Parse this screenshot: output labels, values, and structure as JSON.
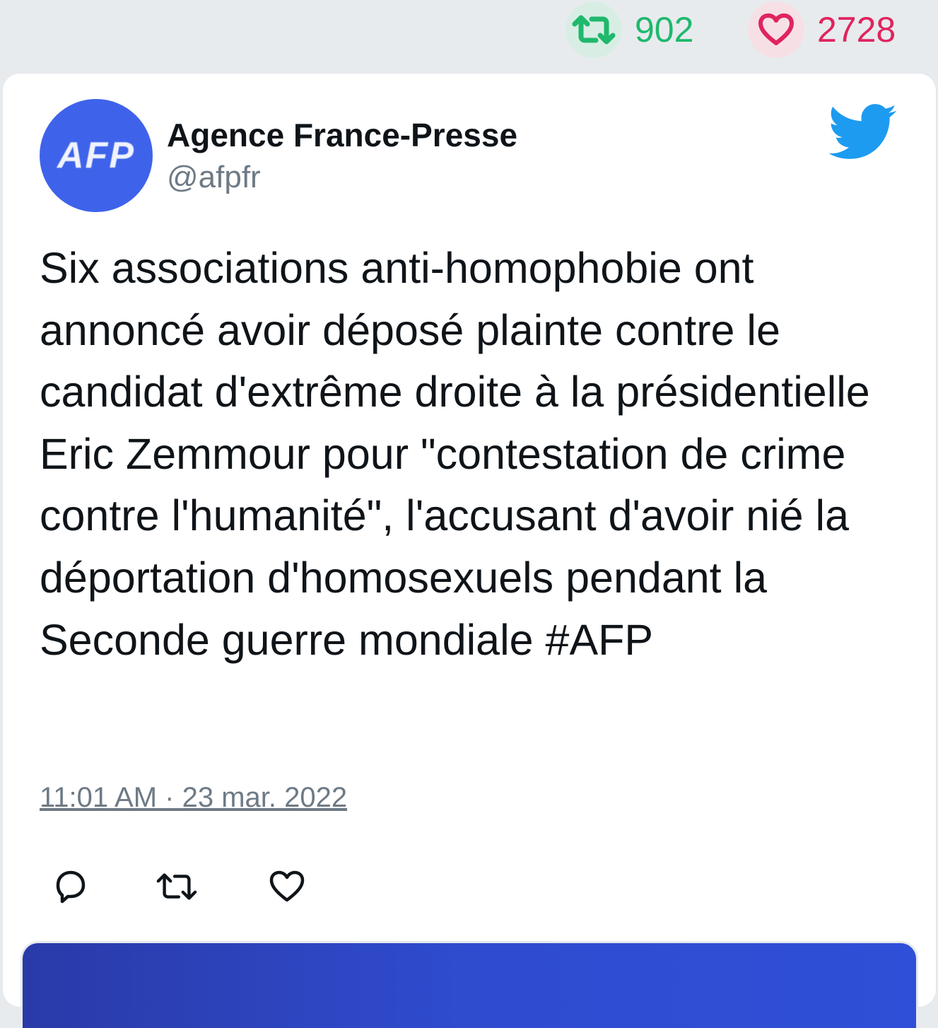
{
  "stats": {
    "retweets": "902",
    "likes": "2728",
    "retweet_color": "#1fb86d",
    "like_color": "#e0245e"
  },
  "tweet": {
    "avatar_text": "AFP",
    "author_name": "Agence France-Presse",
    "author_handle": "@afpfr",
    "text": "Six associations anti-homophobie ont annoncé avoir déposé plainte contre le candidat d'extrême droite à la présidentielle Eric Zemmour pour \"contestation de crime contre l'humanité\", l'accusant d'avoir nié la déportation d'homosexuels pendant la Seconde guerre mondiale #AFP",
    "timestamp": "11:01 AM · 23 mar. 2022",
    "brand_color": "#1d9bf0",
    "avatar_color": "#3e63ea"
  },
  "icons": {
    "stat_retweet": "retweet-icon",
    "stat_like": "heart-icon",
    "brand": "twitter-bird-icon",
    "reply": "reply-icon",
    "retweet": "retweet-icon",
    "like": "heart-icon"
  }
}
